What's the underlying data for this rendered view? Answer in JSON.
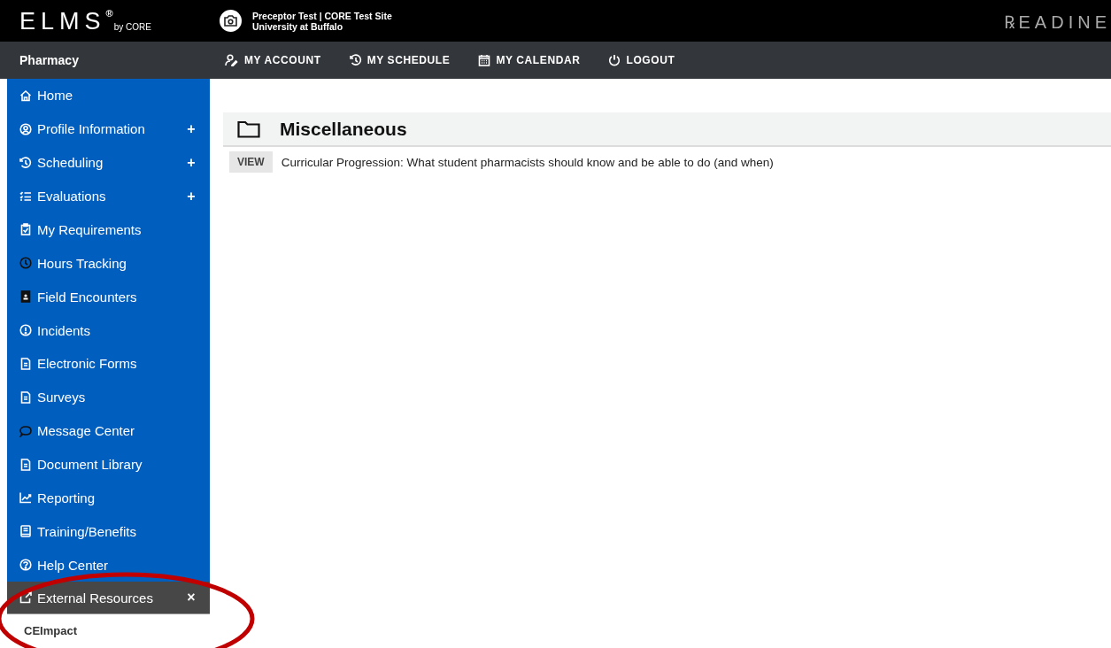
{
  "header": {
    "logo": {
      "text": "ELMS",
      "mark": "®",
      "byline": "by CORE"
    },
    "site": {
      "line1": "Preceptor Test | CORE Test Site",
      "line2": "University at Buffalo"
    },
    "brand": "℞EADINE"
  },
  "navbar": {
    "program": "Pharmacy",
    "links": [
      {
        "label": "MY ACCOUNT",
        "kind": "account"
      },
      {
        "label": "MY SCHEDULE",
        "kind": "schedule"
      },
      {
        "label": "MY CALENDAR",
        "kind": "calendar"
      },
      {
        "label": "LOGOUT",
        "kind": "power"
      }
    ]
  },
  "sidebar": {
    "items": [
      {
        "label": "Home",
        "kind": "home"
      },
      {
        "label": "Profile Information",
        "kind": "profile",
        "toggle": "+"
      },
      {
        "label": "Scheduling",
        "kind": "schedule",
        "toggle": "+"
      },
      {
        "label": "Evaluations",
        "kind": "list",
        "toggle": "+"
      },
      {
        "label": "My Requirements",
        "kind": "clipboard"
      },
      {
        "label": "Hours Tracking",
        "kind": "clock"
      },
      {
        "label": "Field Encounters",
        "kind": "badge"
      },
      {
        "label": "Incidents",
        "kind": "alert"
      },
      {
        "label": "Electronic Forms",
        "kind": "doc"
      },
      {
        "label": "Surveys",
        "kind": "doc"
      },
      {
        "label": "Message Center",
        "kind": "chat"
      },
      {
        "label": "Document Library",
        "kind": "doc"
      },
      {
        "label": "Reporting",
        "kind": "chart"
      },
      {
        "label": "Training/Benefits",
        "kind": "book"
      },
      {
        "label": "Help Center",
        "kind": "help"
      },
      {
        "label": "External Resources",
        "kind": "external",
        "toggle": "×",
        "expanded": true,
        "children": [
          {
            "label": "CEImpact"
          }
        ]
      }
    ]
  },
  "content": {
    "section": {
      "title": "Miscellaneous",
      "rows": [
        {
          "button": "VIEW",
          "text": "Curricular Progression: What student pharmacists should know and be able to do (and when)"
        }
      ]
    }
  },
  "annotation": {
    "kind": "ellipse"
  }
}
